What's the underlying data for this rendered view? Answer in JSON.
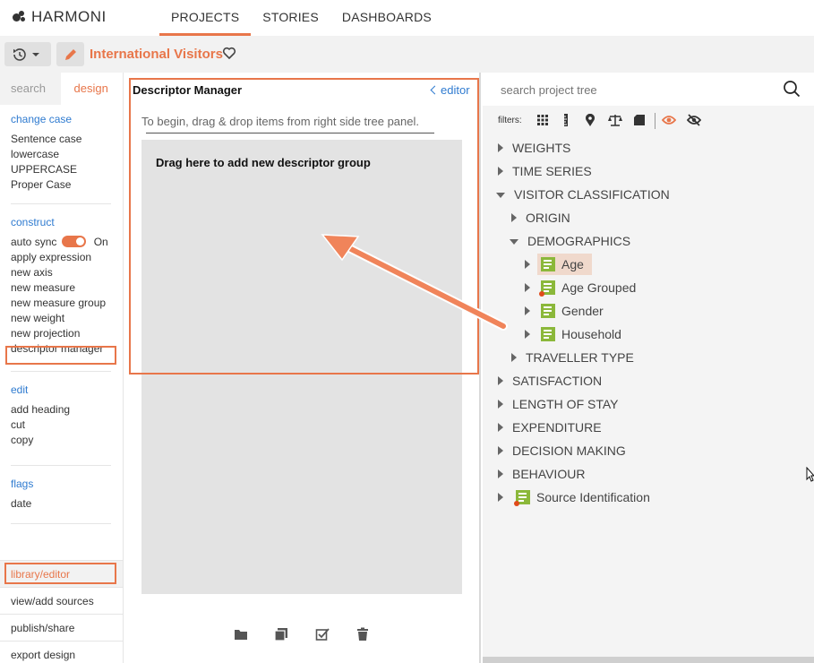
{
  "app": {
    "logo": "HARMONI"
  },
  "nav": {
    "tabs": [
      "PROJECTS",
      "STORIES",
      "DASHBOARDS"
    ],
    "active": "PROJECTS"
  },
  "toolbar": {
    "title": "International Visitors"
  },
  "left": {
    "tabs": {
      "search": "search",
      "design": "design"
    },
    "change_case": {
      "title": "change case",
      "items": [
        "Sentence case",
        "lowercase",
        "UPPERCASE",
        "Proper Case"
      ]
    },
    "construct": {
      "title": "construct",
      "auto_sync": "auto sync",
      "auto_sync_state": "On",
      "items": [
        "apply expression",
        "new axis",
        "new measure",
        "new measure group",
        "new weight",
        "new projection",
        "descriptor manager"
      ]
    },
    "edit": {
      "title": "edit",
      "items": [
        "add heading",
        "cut",
        "copy"
      ]
    },
    "flags": {
      "title": "flags",
      "items": [
        "date"
      ]
    },
    "bottom": [
      "library/editor",
      "view/add sources",
      "publish/share",
      "export design"
    ]
  },
  "descriptor_manager": {
    "title": "Descriptor Manager",
    "editor_link": "editor",
    "hint": "To begin, drag & drop items from right side tree panel.",
    "dropzone_label": "Drag here to add new descriptor group",
    "bottom_icons": [
      "folder-icon",
      "copy-icon",
      "checkbox-icon",
      "trash-icon"
    ]
  },
  "tree": {
    "search_placeholder": "search project tree",
    "filters_label": "filters:",
    "nodes": [
      {
        "label": "WEIGHTS"
      },
      {
        "label": "TIME SERIES"
      },
      {
        "label": "VISITOR CLASSIFICATION"
      },
      {
        "label": "ORIGIN"
      },
      {
        "label": "DEMOGRAPHICS"
      },
      {
        "label": "Age"
      },
      {
        "label": "Age Grouped"
      },
      {
        "label": "Gender"
      },
      {
        "label": "Household"
      },
      {
        "label": "TRAVELLER TYPE"
      },
      {
        "label": "SATISFACTION"
      },
      {
        "label": "LENGTH OF STAY"
      },
      {
        "label": "EXPENDITURE"
      },
      {
        "label": "DECISION MAKING"
      },
      {
        "label": "BEHAVIOUR"
      },
      {
        "label": "Source Identification"
      }
    ]
  },
  "colors": {
    "accent": "#e8764a",
    "link": "#2f7bd0",
    "variable": "#8bb83a"
  }
}
